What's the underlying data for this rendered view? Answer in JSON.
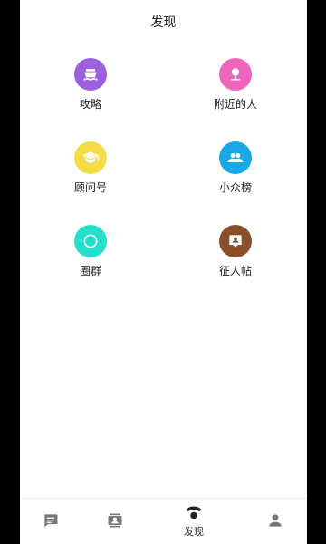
{
  "header": {
    "title": "发现"
  },
  "grid": [
    {
      "label": "攻略",
      "icon": "ship-icon",
      "color": "#9C5FE0"
    },
    {
      "label": "附近的人",
      "icon": "nearby-person-icon",
      "color": "#EE66BB"
    },
    {
      "label": "顾问号",
      "icon": "graduation-cap-icon",
      "color": "#F6DC44"
    },
    {
      "label": "小众榜",
      "icon": "group-icon",
      "color": "#1AA7E8"
    },
    {
      "label": "圈群",
      "icon": "circle-icon",
      "color": "#22E0CC"
    },
    {
      "label": "征人帖",
      "icon": "person-post-icon",
      "color": "#8A4E29"
    }
  ],
  "tabbar": {
    "items": [
      {
        "label": "",
        "icon": "message-icon"
      },
      {
        "label": "",
        "icon": "contacts-icon"
      },
      {
        "label": "发现",
        "icon": "discover-icon",
        "active": true
      },
      {
        "label": "",
        "icon": "profile-icon"
      }
    ]
  }
}
